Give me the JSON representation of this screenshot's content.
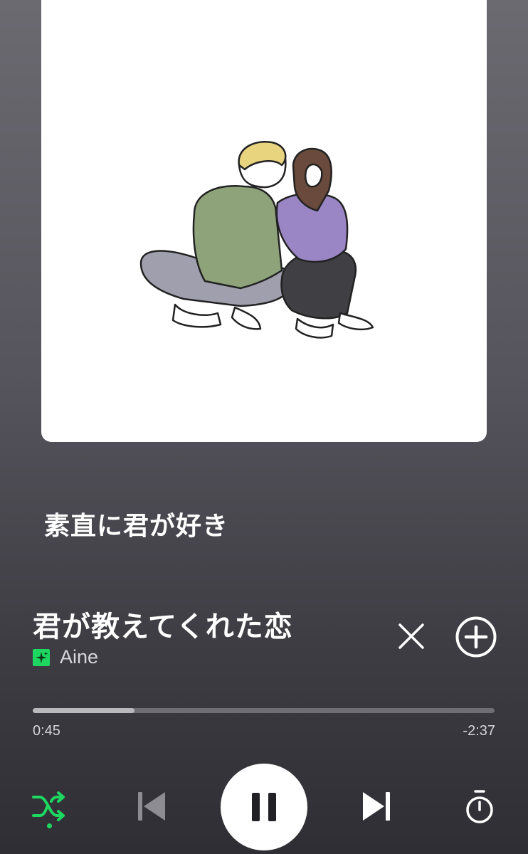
{
  "playlist": {
    "title": "素直に君が好き"
  },
  "track": {
    "title": "君が教えてくれた恋",
    "artist": "Aine"
  },
  "progress": {
    "elapsed": "0:45",
    "remaining": "-2:37",
    "fraction": 0.22
  },
  "colors": {
    "accent": "#1ed760",
    "shuffle_active": "#1ed760"
  },
  "icons": {
    "close": "close-icon",
    "add": "plus-circle-icon",
    "shuffle": "shuffle-icon",
    "previous": "skip-previous-icon",
    "pause": "pause-icon",
    "next": "skip-next-icon",
    "timer": "sleep-timer-icon"
  }
}
